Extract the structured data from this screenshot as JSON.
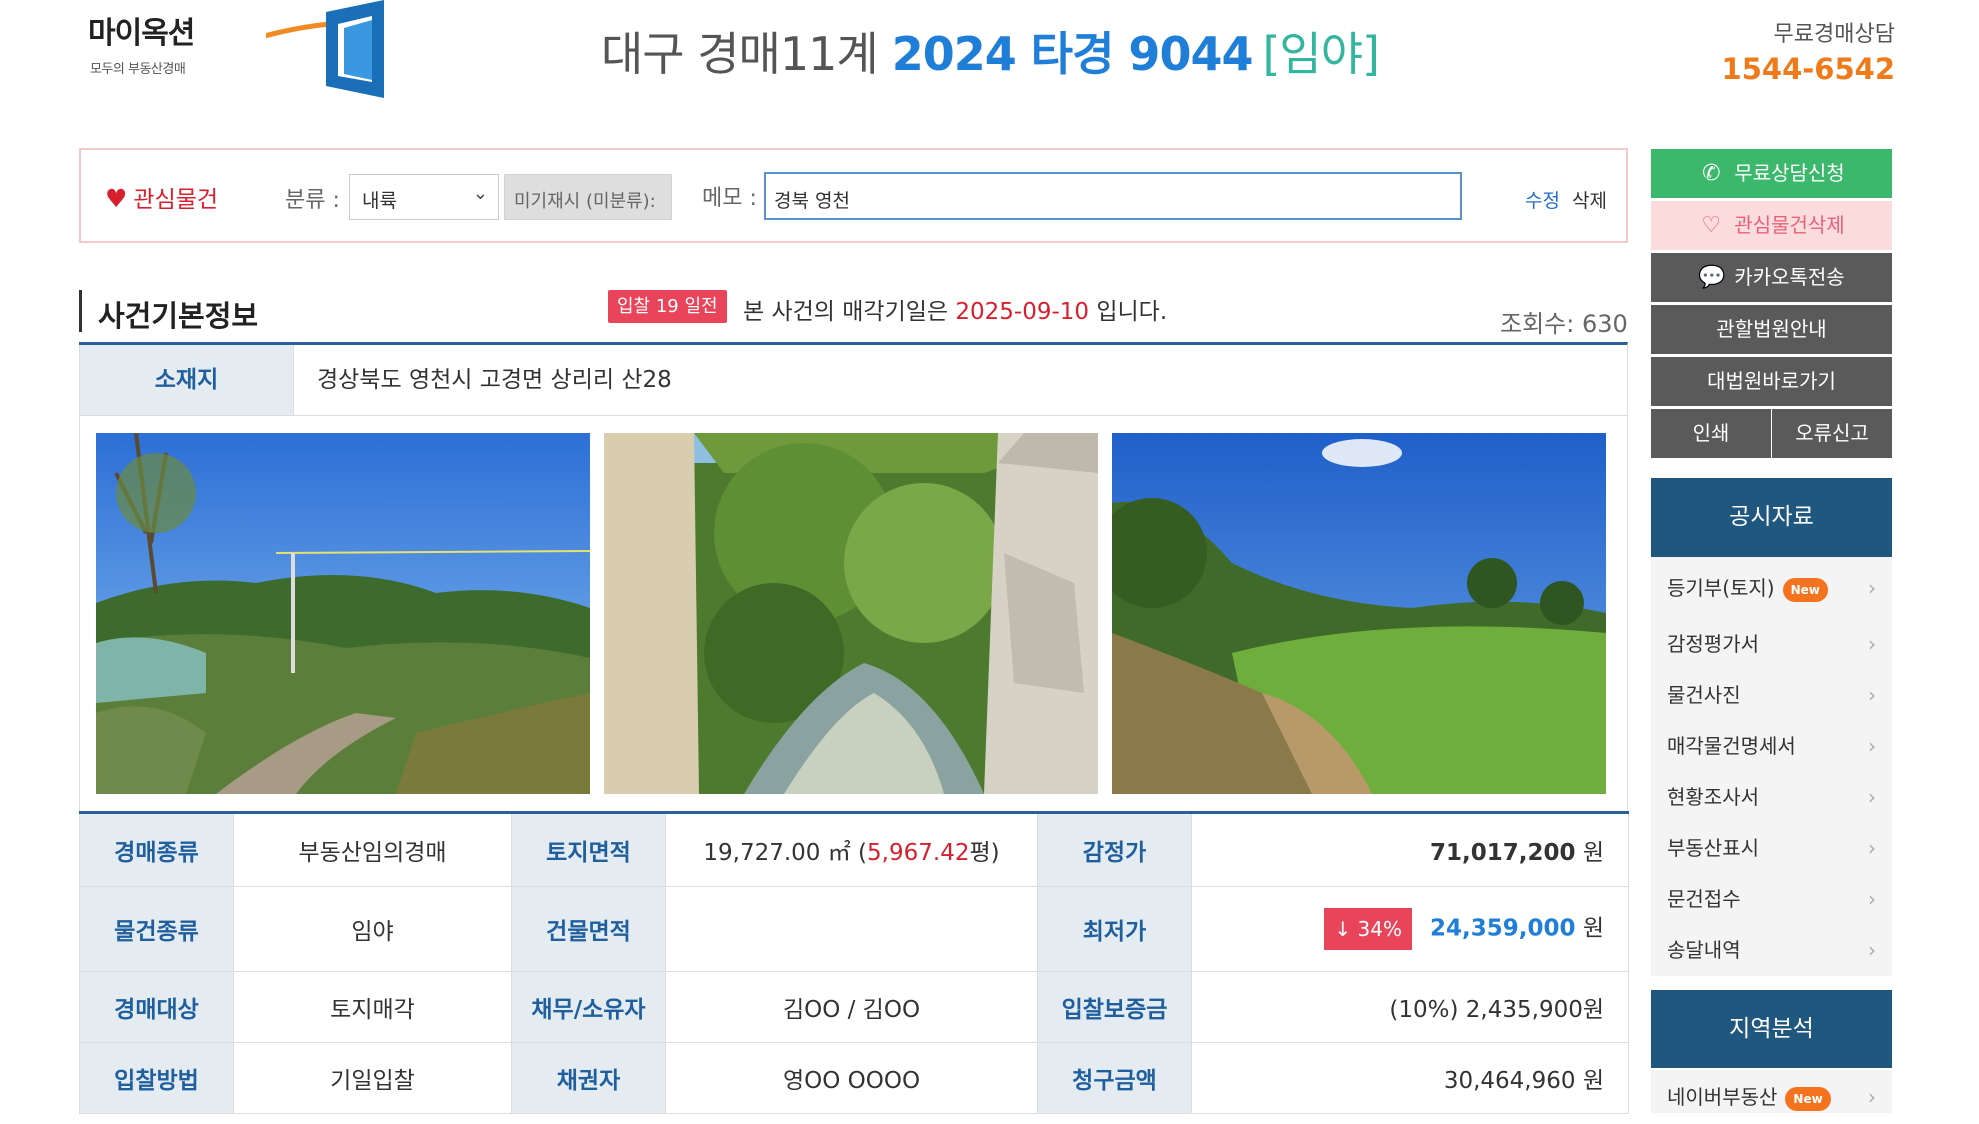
{
  "header": {
    "logo_text": "마이옥션",
    "logo_sub": "모두의 부동산경매",
    "court": "대구 경매11계",
    "case_no": "2024 타경 9044",
    "kind": "[임야]",
    "consult_label": "무료경매상담",
    "consult_phone": "1544-6542"
  },
  "memo_bar": {
    "favorite_label": "관심물건",
    "category_label": "분류 :",
    "category_value": "내륙",
    "unrelated_button": "미기재시 (미분류):",
    "memo_label": "메모 :",
    "memo_value": "경북 영천",
    "edit": "수정",
    "delete": "삭제"
  },
  "section": {
    "title": "사건기본정보",
    "dday_badge": "입찰 19 일전",
    "sale_prefix": "본 사건의 매각기일은",
    "sale_date": "2025-09-10",
    "sale_suffix": "입니다.",
    "views": "조회수: 630"
  },
  "location": {
    "label": "소재지",
    "value": "경상북도 영천시 고경면 상리리 산28"
  },
  "photos": [
    {
      "name": "property-photo-road"
    },
    {
      "name": "property-photo-stream"
    },
    {
      "name": "property-photo-field"
    }
  ],
  "info": {
    "auction_type_label": "경매종류",
    "auction_type": "부동산임의경매",
    "land_area_label": "토지면적",
    "land_area_m2": "19,727.00 ㎡",
    "land_area_pyeong": "5,967.42",
    "pyeong_unit": "평",
    "appraisal_label": "감정가",
    "appraisal": "71,017,200",
    "property_type_label": "물건종류",
    "property_type": "임야",
    "building_area_label": "건물면적",
    "building_area": "",
    "min_price_label": "최저가",
    "min_price_badge": "↓ 34%",
    "min_price": "24,359,000",
    "target_label": "경매대상",
    "target": "토지매각",
    "owner_label": "채무/소유자",
    "owner": "김OO / 김OO",
    "deposit_label": "입찰보증금",
    "deposit": "(10%) 2,435,900원",
    "method_label": "입찰방법",
    "method": "기일입찰",
    "creditor_label": "채권자",
    "creditor": "영OO OOOO",
    "claim_label": "청구금액",
    "claim": "30,464,960",
    "won": "원"
  },
  "sidebar": {
    "consult_request": "무료상담신청",
    "fav_delete": "관심물건삭제",
    "kakao": "카카오톡전송",
    "court_info": "관할법원안내",
    "supreme_court": "대법원바로가기",
    "print": "인쇄",
    "report_error": "오류신고",
    "public_docs_title": "공시자료",
    "public_docs": [
      "등기부(토지)",
      "감정평가서",
      "물건사진",
      "매각물건명세서",
      "현황조사서",
      "부동산표시",
      "문건접수",
      "송달내역"
    ],
    "new_badge": "New",
    "region_title": "지역분석",
    "region_items": [
      "네이버부동산"
    ]
  },
  "colors": {
    "primary_blue": "#1e7ed8",
    "table_head": "#e4ebf1",
    "accent_red": "#d81f2d",
    "phone_orange": "#ee7a1a",
    "green": "#3bb86b",
    "navy": "#20577f"
  }
}
